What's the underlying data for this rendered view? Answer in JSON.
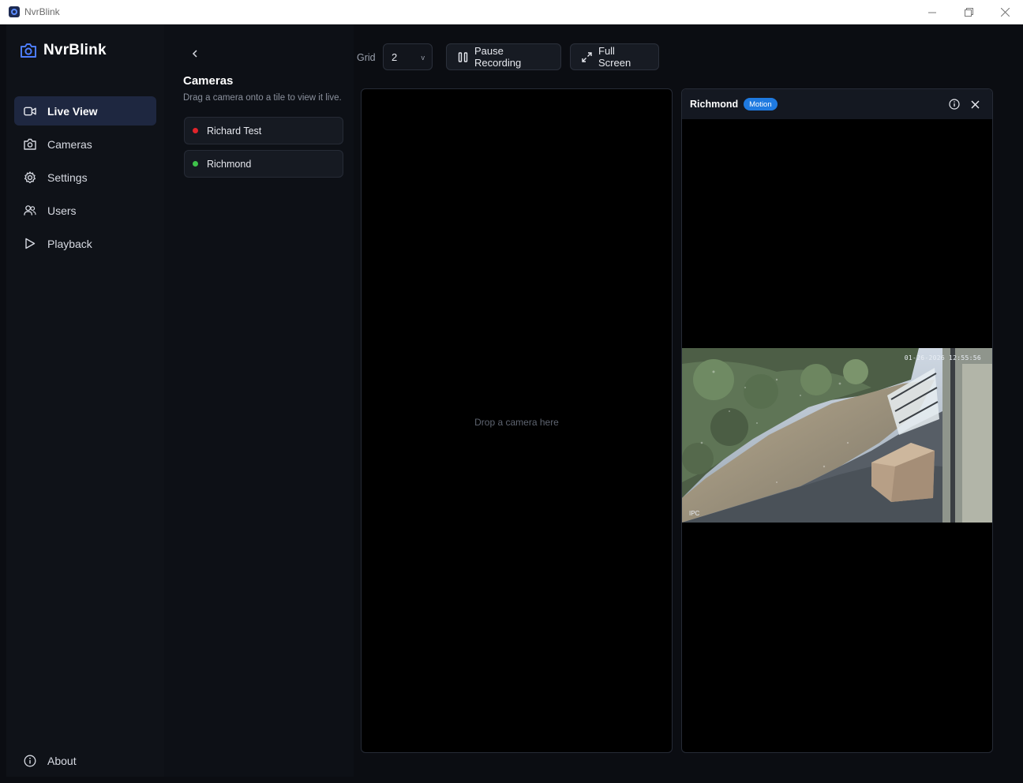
{
  "window": {
    "title": "NvrBlink"
  },
  "brand": {
    "name": "NvrBlink"
  },
  "nav": {
    "items": [
      {
        "label": "Live View",
        "icon": "video-icon",
        "active": true
      },
      {
        "label": "Cameras",
        "icon": "camera-icon",
        "active": false
      },
      {
        "label": "Settings",
        "icon": "gear-icon",
        "active": false
      },
      {
        "label": "Users",
        "icon": "users-icon",
        "active": false
      },
      {
        "label": "Playback",
        "icon": "play-icon",
        "active": false
      }
    ],
    "about": "About"
  },
  "camera_panel": {
    "title": "Cameras",
    "subtitle": "Drag a camera onto a tile to view it live.",
    "cameras": [
      {
        "name": "Richard Test",
        "status_color": "#e0242b"
      },
      {
        "name": "Richmond",
        "status_color": "#3ec24a"
      }
    ]
  },
  "toolbar": {
    "grid_label": "Grid",
    "grid_value": "2",
    "grid_chevron": "v",
    "pause_label": "Pause Recording",
    "fullscreen_label": "Full Screen"
  },
  "tiles": {
    "empty_text": "Drop a camera here",
    "live": {
      "camera": "Richmond",
      "badge": "Motion",
      "timestamp": "01-26-2026 12:55:56",
      "overlay": "IPC"
    }
  }
}
